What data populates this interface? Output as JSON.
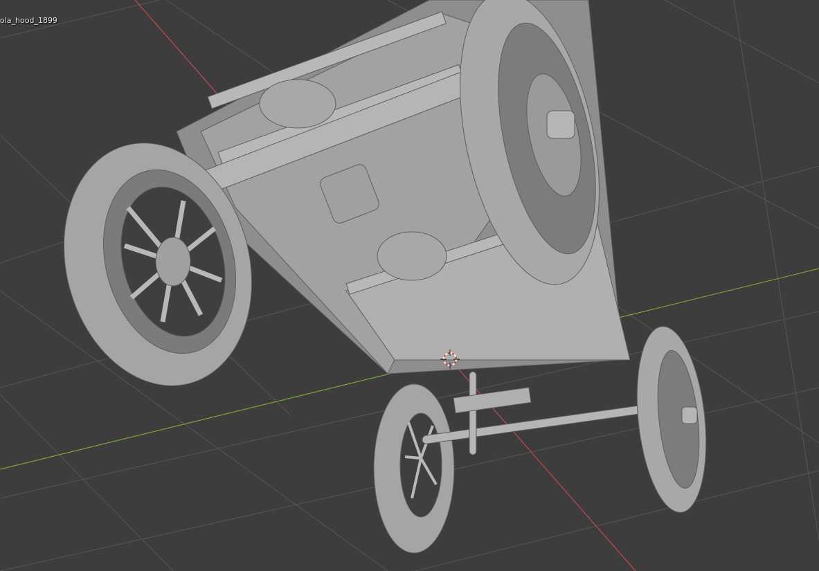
{
  "viewport": {
    "object_name": "ola_hood_1899",
    "colors": {
      "background": "#3d3d3d",
      "grid": "#555555",
      "x_axis": "#c9474f",
      "y_axis": "#7aa53a",
      "model": "#9a9a9a"
    }
  }
}
